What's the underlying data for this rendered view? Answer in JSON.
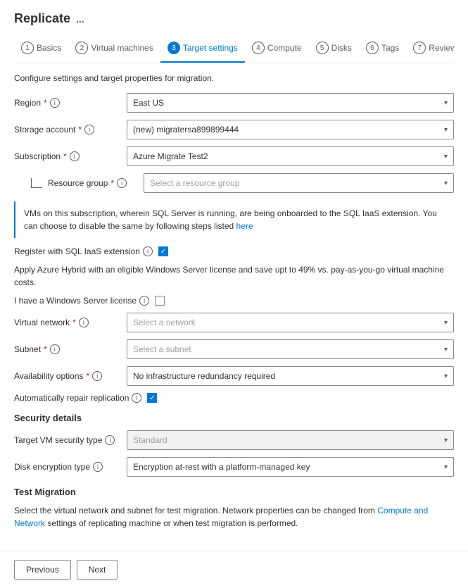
{
  "page": {
    "title": "Replicate",
    "ellipsis": "...",
    "subtitle": "Configure settings and target properties for migration."
  },
  "wizard": {
    "steps": [
      {
        "number": "1",
        "label": "Basics",
        "active": false
      },
      {
        "number": "2",
        "label": "Virtual machines",
        "active": false
      },
      {
        "number": "3",
        "label": "Target settings",
        "active": true
      },
      {
        "number": "4",
        "label": "Compute",
        "active": false
      },
      {
        "number": "5",
        "label": "Disks",
        "active": false
      },
      {
        "number": "6",
        "label": "Tags",
        "active": false
      },
      {
        "number": "7",
        "label": "Review + Start replication",
        "active": false
      }
    ]
  },
  "form": {
    "region_label": "Region",
    "region_value": "East US",
    "storage_account_label": "Storage account",
    "storage_account_value": "(new) migratersa899899444",
    "subscription_label": "Subscription",
    "subscription_value": "Azure Migrate Test2",
    "resource_group_label": "Resource group",
    "resource_group_placeholder": "Select a resource group",
    "sql_info_message": "VMs on this subscription, wherein SQL Server is running, are being onboarded to the SQL IaaS extension. You can choose to disable the same by following steps listed",
    "sql_link": "here",
    "register_sql_label": "Register with SQL IaaS extension",
    "hybrid_notice": "Apply Azure Hybrid with an eligible Windows Server license and save upt to 49% vs. pay-as-you-go virtual machine costs.",
    "windows_license_label": "I have a Windows Server license",
    "virtual_network_label": "Virtual network",
    "virtual_network_placeholder": "Select a network",
    "subnet_label": "Subnet",
    "subnet_placeholder": "Select a subnet",
    "availability_label": "Availability options",
    "availability_value": "No infrastructure redundancy required",
    "auto_repair_label": "Automatically repair replication",
    "security_section": "Security details",
    "target_vm_security_label": "Target VM security type",
    "target_vm_security_value": "Standard",
    "disk_encryption_label": "Disk encryption type",
    "disk_encryption_value": "Encryption at-rest with a platform-managed key",
    "test_migration_section": "Test Migration",
    "test_migration_note": "Select the virtual network and subnet for test migration. Network properties can be changed from Compute and Network settings of replicating machine or when test migration is performed."
  },
  "buttons": {
    "previous": "Previous",
    "next": "Next"
  },
  "links": {
    "compute_and_network": "Compute and Network"
  }
}
